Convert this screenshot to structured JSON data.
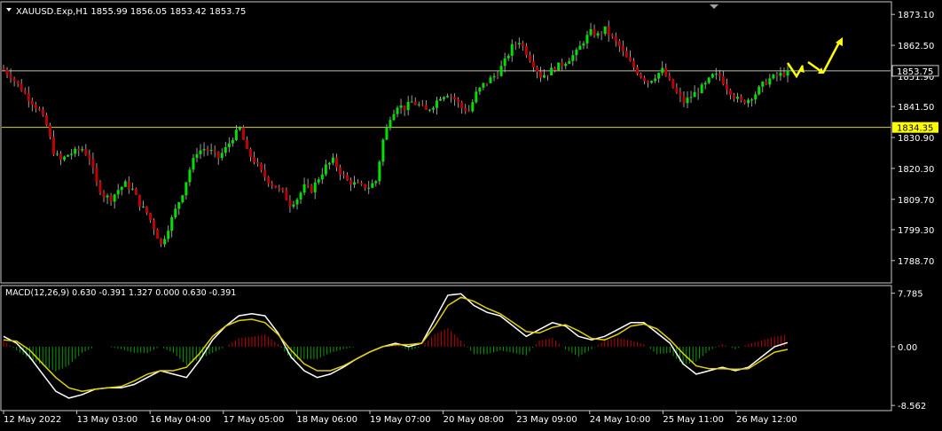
{
  "window": {
    "header": "XAUUSD.Exp,H1  1855.99 1856.05 1853.42 1853.75",
    "bg": "#000000",
    "frame_color": "#c8c8c8"
  },
  "price_panel": {
    "y_range": [
      1785.0,
      1875.6
    ],
    "ticks": [
      "1873.10",
      "1862.50",
      "1851.90",
      "1841.50",
      "1830.90",
      "1820.30",
      "1809.70",
      "1799.30",
      "1788.70"
    ],
    "tick_values": [
      1873.1,
      1862.5,
      1851.9,
      1841.5,
      1830.9,
      1820.3,
      1809.7,
      1799.3,
      1788.7
    ],
    "hlines": [
      {
        "value": 1853.75,
        "label": "1853.75",
        "label_bg": "#000000",
        "label_fg": "#ffffff",
        "line": "#c0c0a0"
      },
      {
        "value": 1834.35,
        "label": "1834.35",
        "label_bg": "#ffff00",
        "label_fg": "#000000",
        "line": "#d8d800"
      }
    ],
    "bull_color": "#00e000",
    "bear_color": "#c00000",
    "wick_color": "#c0c0c0",
    "arrow_color": "#ffff00",
    "arrow_path": [
      [
        1853.5,
        1850.6
      ],
      [
        1854.0,
        1852.0
      ],
      [
        1851.2,
        1853.8
      ],
      [
        1854.2,
        1852.4
      ],
      [
        1863.2
      ]
    ]
  },
  "macd_panel": {
    "label": "MACD(12,26,9) 0.630 -0.391 1.327 0.000 0.630 -0.391",
    "y_range": [
      -8.8,
      8.0
    ],
    "ticks": [
      "7.785",
      "0.00",
      "-8.562"
    ],
    "tick_values": [
      7.785,
      0.0,
      -8.562
    ],
    "macd_color": "#ffffff",
    "signal_color": "#e0d000",
    "hist_pos": "#c00000",
    "hist_neg": "#00a000"
  },
  "time_axis": {
    "labels": [
      "12 May 2022",
      "13 May 03:00",
      "16 May 04:00",
      "17 May 05:00",
      "18 May 06:00",
      "19 May 07:00",
      "20 May 08:00",
      "23 May 09:00",
      "24 May 10:00",
      "25 May 11:00",
      "26 May 12:00"
    ]
  },
  "chart_data": {
    "type": "candlestick",
    "symbol": "XAUUSD.Exp",
    "timeframe": "H1",
    "bars_summary_close": [
      1854,
      1852,
      1849,
      1846,
      1843,
      1840,
      1835,
      1826,
      1823,
      1825,
      1826,
      1827,
      1824,
      1815,
      1811,
      1810,
      1813,
      1815,
      1813,
      1808,
      1805,
      1800,
      1794,
      1800,
      1806,
      1812,
      1820,
      1826,
      1827,
      1826,
      1824,
      1827,
      1831,
      1834,
      1826,
      1823,
      1819,
      1816,
      1814,
      1812,
      1808,
      1810,
      1814,
      1813,
      1817,
      1821,
      1823,
      1819,
      1816,
      1815,
      1814,
      1814,
      1816,
      1830,
      1838,
      1842,
      1841,
      1843,
      1842,
      1840,
      1842,
      1845,
      1846,
      1844,
      1841,
      1840,
      1846,
      1849,
      1851,
      1853,
      1857,
      1862,
      1864,
      1860,
      1856,
      1852,
      1853,
      1855,
      1856,
      1858,
      1860,
      1864,
      1867,
      1866,
      1868,
      1865,
      1862,
      1858,
      1855,
      1852,
      1850,
      1852,
      1854,
      1850,
      1846,
      1843,
      1845,
      1847,
      1849,
      1852,
      1852,
      1848,
      1845,
      1843,
      1844,
      1846,
      1849,
      1851,
      1852,
      1853
    ],
    "macd_summary": [
      1.5,
      0.5,
      -1.5,
      -4.0,
      -6.5,
      -7.5,
      -7.0,
      -6.2,
      -6.0,
      -6.0,
      -5.5,
      -4.5,
      -3.5,
      -4.0,
      -4.5,
      -2.0,
      1.0,
      3.0,
      4.5,
      4.8,
      4.5,
      2.0,
      -1.5,
      -3.5,
      -4.5,
      -4.0,
      -3.0,
      -1.8,
      -0.8,
      0.0,
      0.5,
      0.0,
      0.5,
      4.0,
      7.5,
      7.7,
      6.0,
      5.0,
      4.5,
      3.0,
      1.5,
      2.5,
      3.5,
      3.0,
      1.5,
      1.0,
      1.5,
      2.5,
      3.5,
      3.5,
      2.0,
      0.5,
      -2.5,
      -4.0,
      -3.5,
      -3.0,
      -3.5,
      -3.0,
      -1.5,
      0.0,
      0.6
    ],
    "signal_summary": [
      1.0,
      0.8,
      -0.5,
      -2.5,
      -4.5,
      -6.0,
      -6.5,
      -6.2,
      -6.0,
      -5.8,
      -5.0,
      -4.0,
      -3.5,
      -3.5,
      -3.0,
      -1.0,
      1.5,
      3.0,
      3.8,
      4.0,
      3.5,
      1.8,
      -0.5,
      -2.5,
      -3.5,
      -3.5,
      -2.8,
      -1.8,
      -0.8,
      0.0,
      0.3,
      0.3,
      0.5,
      3.0,
      6.0,
      7.2,
      6.6,
      5.6,
      4.8,
      3.5,
      2.2,
      2.0,
      2.8,
      3.2,
      2.3,
      1.2,
      1.0,
      1.8,
      3.0,
      3.3,
      2.6,
      1.0,
      -1.0,
      -2.8,
      -3.2,
      -3.2,
      -3.3,
      -3.2,
      -2.0,
      -0.8,
      -0.4
    ]
  }
}
